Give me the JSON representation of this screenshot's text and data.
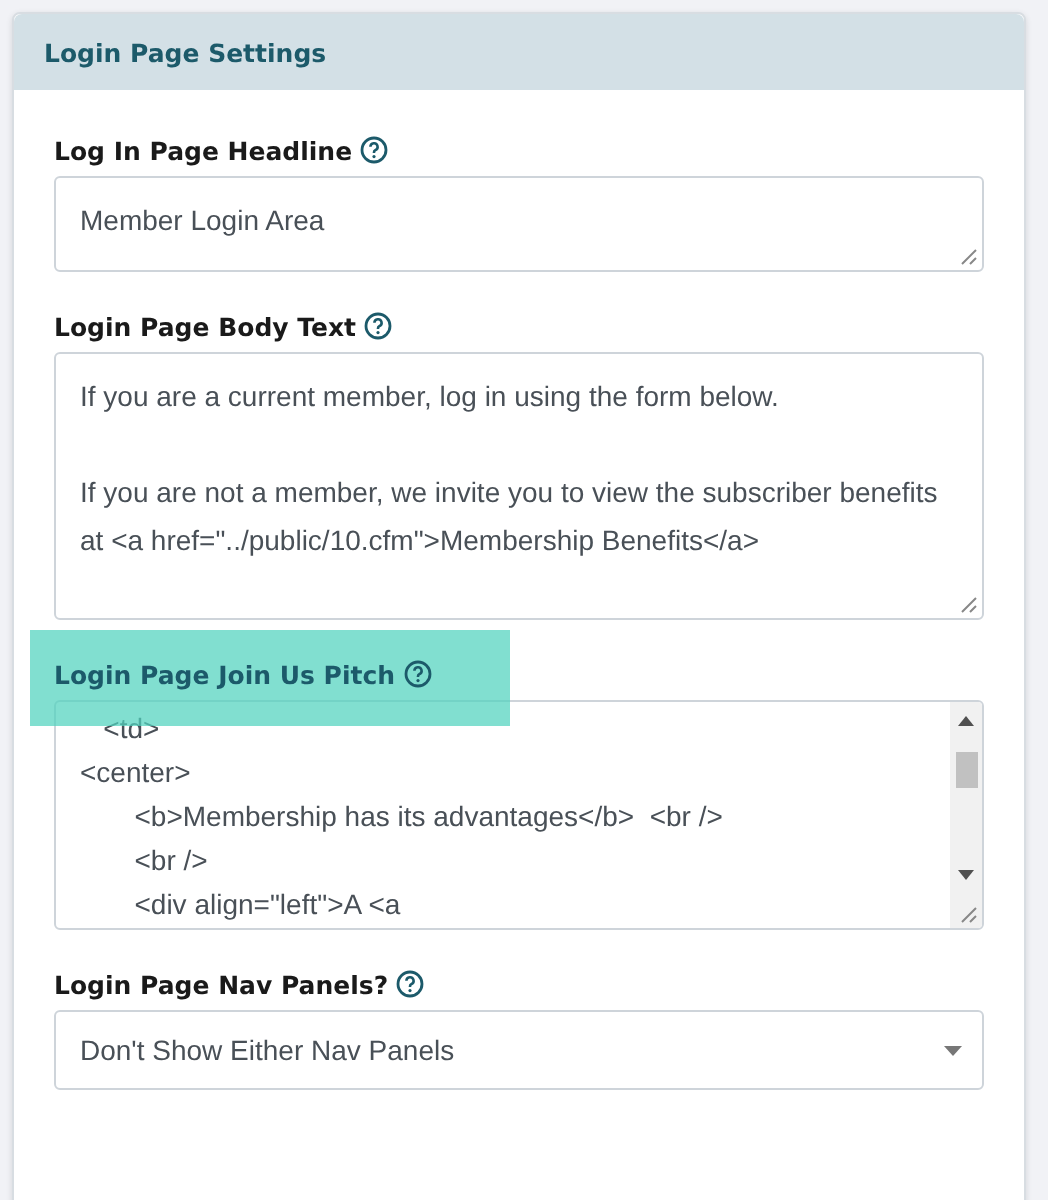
{
  "panel": {
    "title": "Login Page Settings"
  },
  "fields": [
    {
      "kind": "textarea",
      "label": "Log In Page Headline",
      "highlighted": false,
      "value": "Member Login Area"
    },
    {
      "kind": "textarea",
      "label": "Login Page Body Text",
      "highlighted": false,
      "value": "If you are a current member, log in using the form below.\n\nIf you are not a member, we invite you to view the subscriber benefits at <a href=\"../public/10.cfm\">Membership Benefits</a>"
    },
    {
      "kind": "code",
      "label": "Login Page Join Us Pitch",
      "highlighted": true,
      "value": "   <td>\n<center>\n       <b>Membership has its advantages</b>  <br />\n       <br />\n       <div align=\"left\">A <a"
    },
    {
      "kind": "select",
      "label": "Login Page Nav Panels?",
      "highlighted": false,
      "value": "Don't Show Either Nav Panels"
    }
  ]
}
